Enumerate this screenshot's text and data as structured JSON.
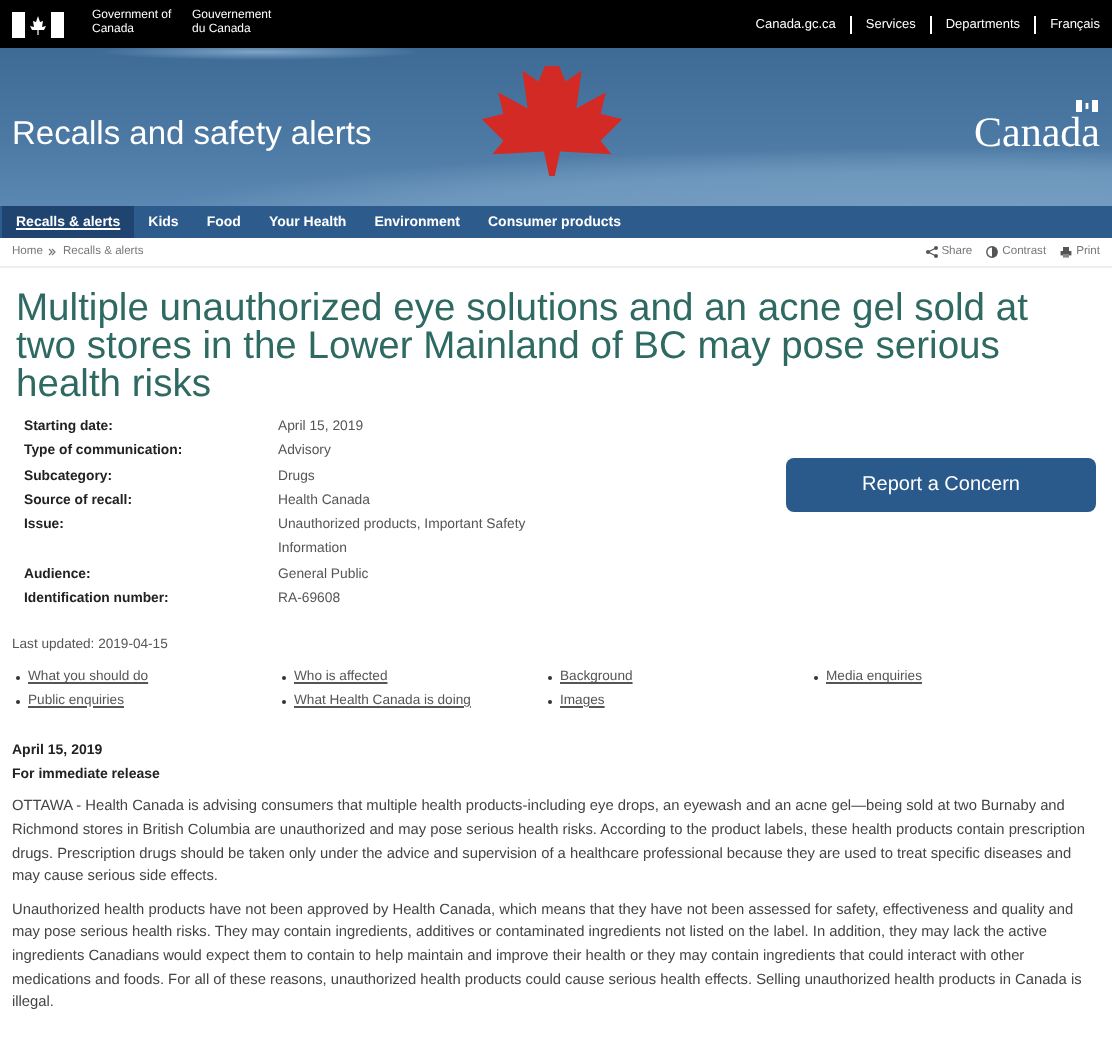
{
  "top_bar": {
    "government_en": "Government of Canada",
    "government_fr": "Gouvernement du Canada",
    "links": [
      "Canada.gc.ca",
      "Services",
      "Departments",
      "Français"
    ]
  },
  "banner": {
    "title": "Recalls and safety alerts",
    "wordmark": "Canada"
  },
  "nav": [
    {
      "label": "Recalls & alerts",
      "selected": true
    },
    {
      "label": "Kids",
      "selected": false
    },
    {
      "label": "Food",
      "selected": false
    },
    {
      "label": "Your Health",
      "selected": false
    },
    {
      "label": "Environment",
      "selected": false
    },
    {
      "label": "Consumer products",
      "selected": false
    }
  ],
  "breadcrumb": [
    "Home",
    "Recalls & alerts"
  ],
  "page_tools": [
    {
      "kind": "share",
      "label": "Share"
    },
    {
      "kind": "contrast",
      "label": "Contrast"
    },
    {
      "kind": "print",
      "label": "Print"
    }
  ],
  "heading": "Multiple unauthorized eye solutions and an acne gel sold at two stores in the Lower Mainland of BC may pose serious health risks",
  "details": [
    {
      "label": "Starting date:",
      "value": "April 15, 2019"
    },
    {
      "label": "Type of communication:",
      "value": "Advisory"
    },
    {
      "label": "Subcategory:",
      "value": "Drugs"
    },
    {
      "label": "Source of recall:",
      "value": "Health Canada"
    },
    {
      "label": "Issue:",
      "value": "Unauthorized products, Important Safety Information"
    },
    {
      "label": "Audience:",
      "value": "General Public"
    },
    {
      "label": "Identification number:",
      "value": "RA-69608"
    }
  ],
  "report_button": "Report a Concern",
  "last_updated": "Last updated: 2019-04-15",
  "quick_links": [
    [
      "What you should do",
      "Public enquiries"
    ],
    [
      "Who is affected",
      "What Health Canada is doing"
    ],
    [
      "Background",
      "Images"
    ],
    [
      "Media enquiries"
    ]
  ],
  "release_date": "April 15, 2019",
  "release_type": "For immediate release",
  "paragraphs": [
    "OTTAWA - Health Canada is advising consumers that multiple health products-including eye drops, an eyewash and an acne gel—being sold at two Burnaby and Richmond stores in British Columbia are unauthorized and may pose serious health risks. According to the product labels, these health products contain prescription drugs. Prescription drugs should be taken only under the advice and supervision of a healthcare professional because they are used to treat specific diseases and may cause serious side effects.",
    "Unauthorized health products have not been approved by Health Canada, which means that they have not been assessed for safety, effectiveness and quality and may pose serious health risks. They may contain ingredients, additives or contaminated ingredients not listed on the label. In addition, they may lack the active ingredients Canadians would expect them to contain to help maintain and improve their health or they may contain ingredients that could interact with other medications and foods. For all of these reasons, unauthorized health products could cause serious health effects. Selling unauthorized health products in Canada is illegal."
  ]
}
